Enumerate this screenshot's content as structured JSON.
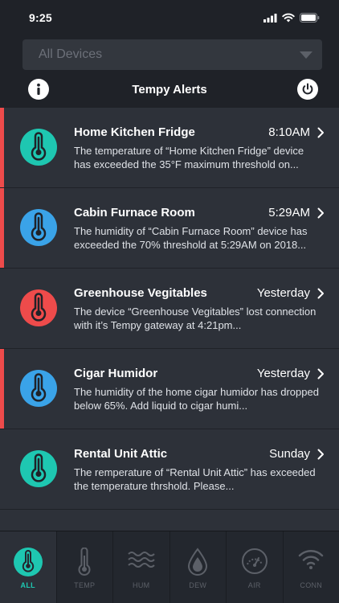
{
  "status_bar": {
    "time": "9:25"
  },
  "device_filter": {
    "selected": "All Devices"
  },
  "header": {
    "title": "Tempy Alerts"
  },
  "alerts": [
    {
      "name": "Home Kitchen Fridge",
      "time": "8:10AM",
      "message": "The temperature of “Home Kitchen Fridge” device has exceeded the 35°F maximum threshold on...",
      "icon_color": "#1ec7b1",
      "unread": true
    },
    {
      "name": "Cabin Furnace Room",
      "time": "5:29AM",
      "message": "The humidity of “Cabin Furnace Room” device has exceeded the 70% threshold at 5:29AM on 2018...",
      "icon_color": "#3aa3e8",
      "unread": true
    },
    {
      "name": "Greenhouse Vegitables",
      "time": "Yesterday",
      "message": "The device “Greenhouse Vegitables” lost connection with it’s Tempy gateway at 4:21pm...",
      "icon_color": "#ee4b4b",
      "unread": false
    },
    {
      "name": "Cigar Humidor",
      "time": "Yesterday",
      "message": "The humidity of the home cigar humidor has dropped below 65%.  Add liquid to cigar humi...",
      "icon_color": "#3aa3e8",
      "unread": true
    },
    {
      "name": "Rental Unit Attic",
      "time": "Sunday",
      "message": "The remperature of  “Rental Unit Attic” has exceeded the temperature thrshold. Please...",
      "icon_color": "#1ec7b1",
      "unread": false
    },
    {
      "name": "",
      "time": "",
      "message": "",
      "icon_color": "#1ec7b1",
      "unread": false
    }
  ],
  "tabs": [
    {
      "label": "ALL",
      "icon": "thermometer-dial-icon",
      "active": true
    },
    {
      "label": "TEMP",
      "icon": "thermometer-icon",
      "active": false
    },
    {
      "label": "HUM",
      "icon": "waves-icon",
      "active": false
    },
    {
      "label": "DEW",
      "icon": "droplet-icon",
      "active": false
    },
    {
      "label": "AIR",
      "icon": "gauge-icon",
      "active": false
    },
    {
      "label": "CONN",
      "icon": "wifi-icon",
      "active": false
    }
  ],
  "colors": {
    "accent": "#1ec7b1",
    "alert_bar": "#ee4b4b",
    "background": "#1f2228",
    "card": "#2d3139"
  }
}
